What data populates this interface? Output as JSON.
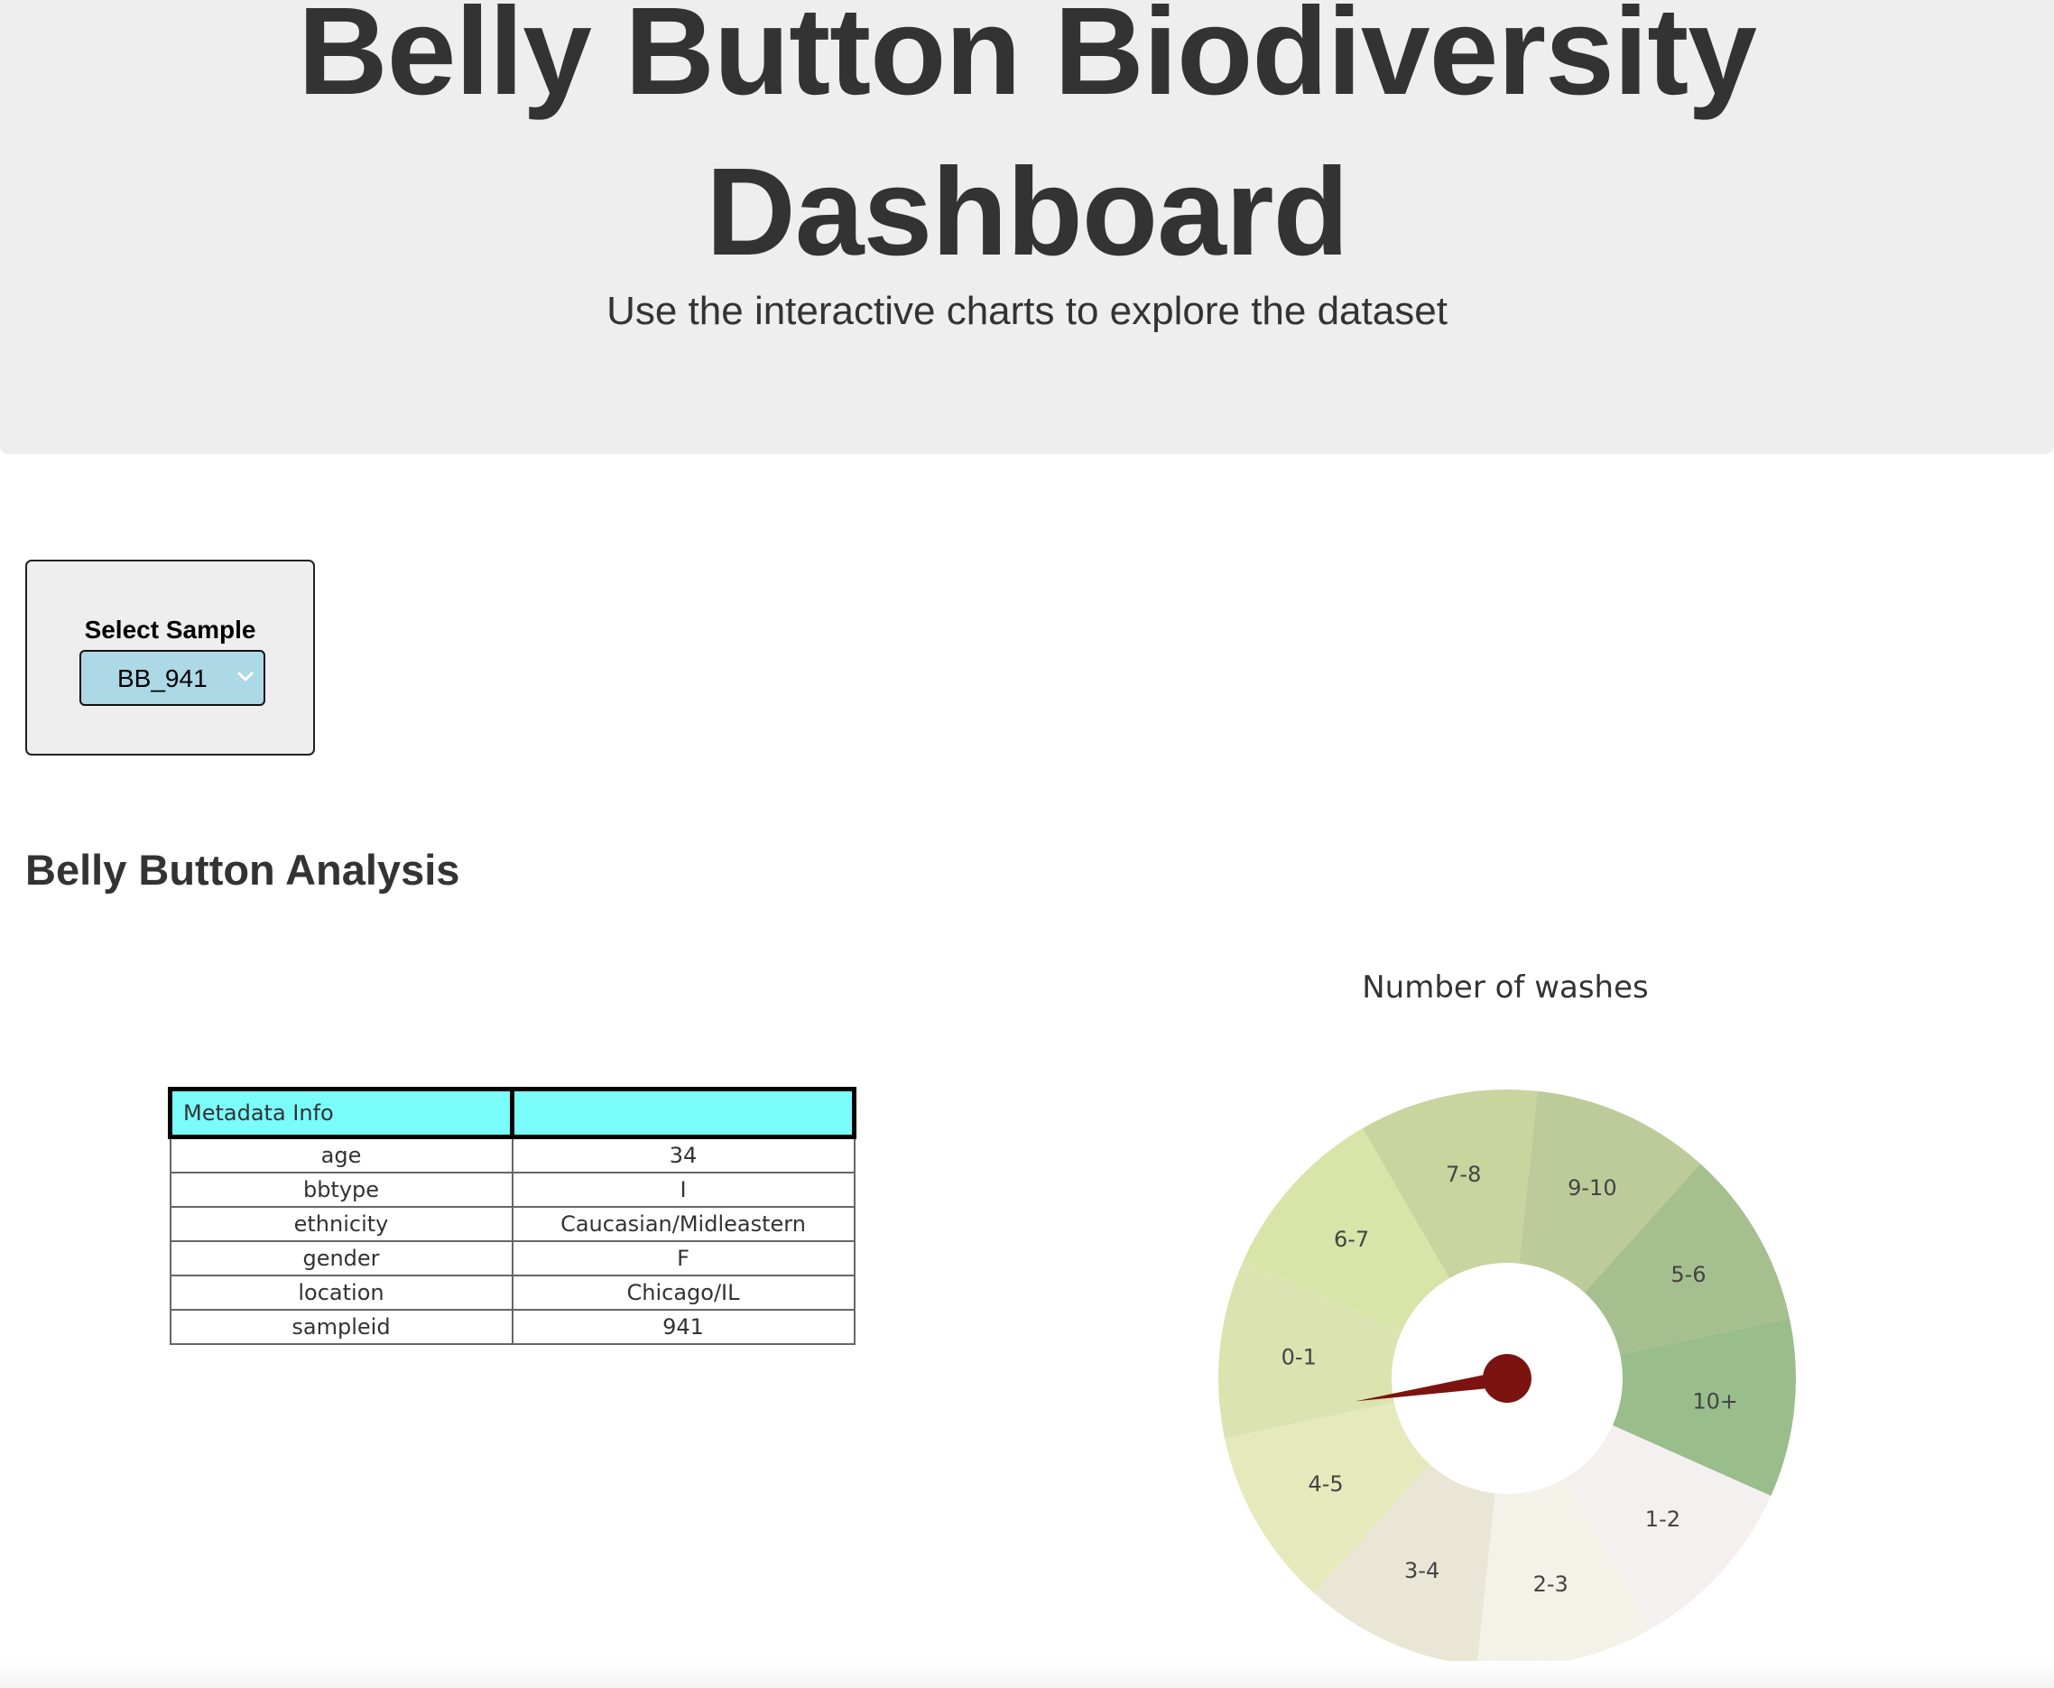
{
  "header": {
    "title": "Belly Button Biodiversity Dashboard",
    "subtitle": "Use the interactive charts to explore the dataset"
  },
  "selector": {
    "label": "Select Sample",
    "value": "BB_941"
  },
  "section_title": "Belly Button Analysis",
  "metadata": {
    "header": [
      "Metadata Info",
      ""
    ],
    "rows": [
      [
        "age",
        "34"
      ],
      [
        "bbtype",
        "I"
      ],
      [
        "ethnicity",
        "Caucasian/Midleastern"
      ],
      [
        "gender",
        "F"
      ],
      [
        "location",
        "Chicago/IL"
      ],
      [
        "sampleid",
        "941"
      ]
    ]
  },
  "chart_data": {
    "type": "pie",
    "title": "Number of washes",
    "labels": [
      "0-1",
      "6-7",
      "7-8",
      "9-10",
      "5-6",
      "10+",
      "1-2",
      "2-3",
      "3-4",
      "4-5"
    ],
    "colors": [
      "#dbe3b0",
      "#d8e4a8",
      "#c9d49e",
      "#bdcb9a",
      "#a6bf8f",
      "#9abd8c",
      "#f4f0ef",
      "#f2f2e8",
      "#eae6d5",
      "#e6e9bb"
    ],
    "needle_value": 0.6,
    "needle_color": "#7b1410"
  }
}
